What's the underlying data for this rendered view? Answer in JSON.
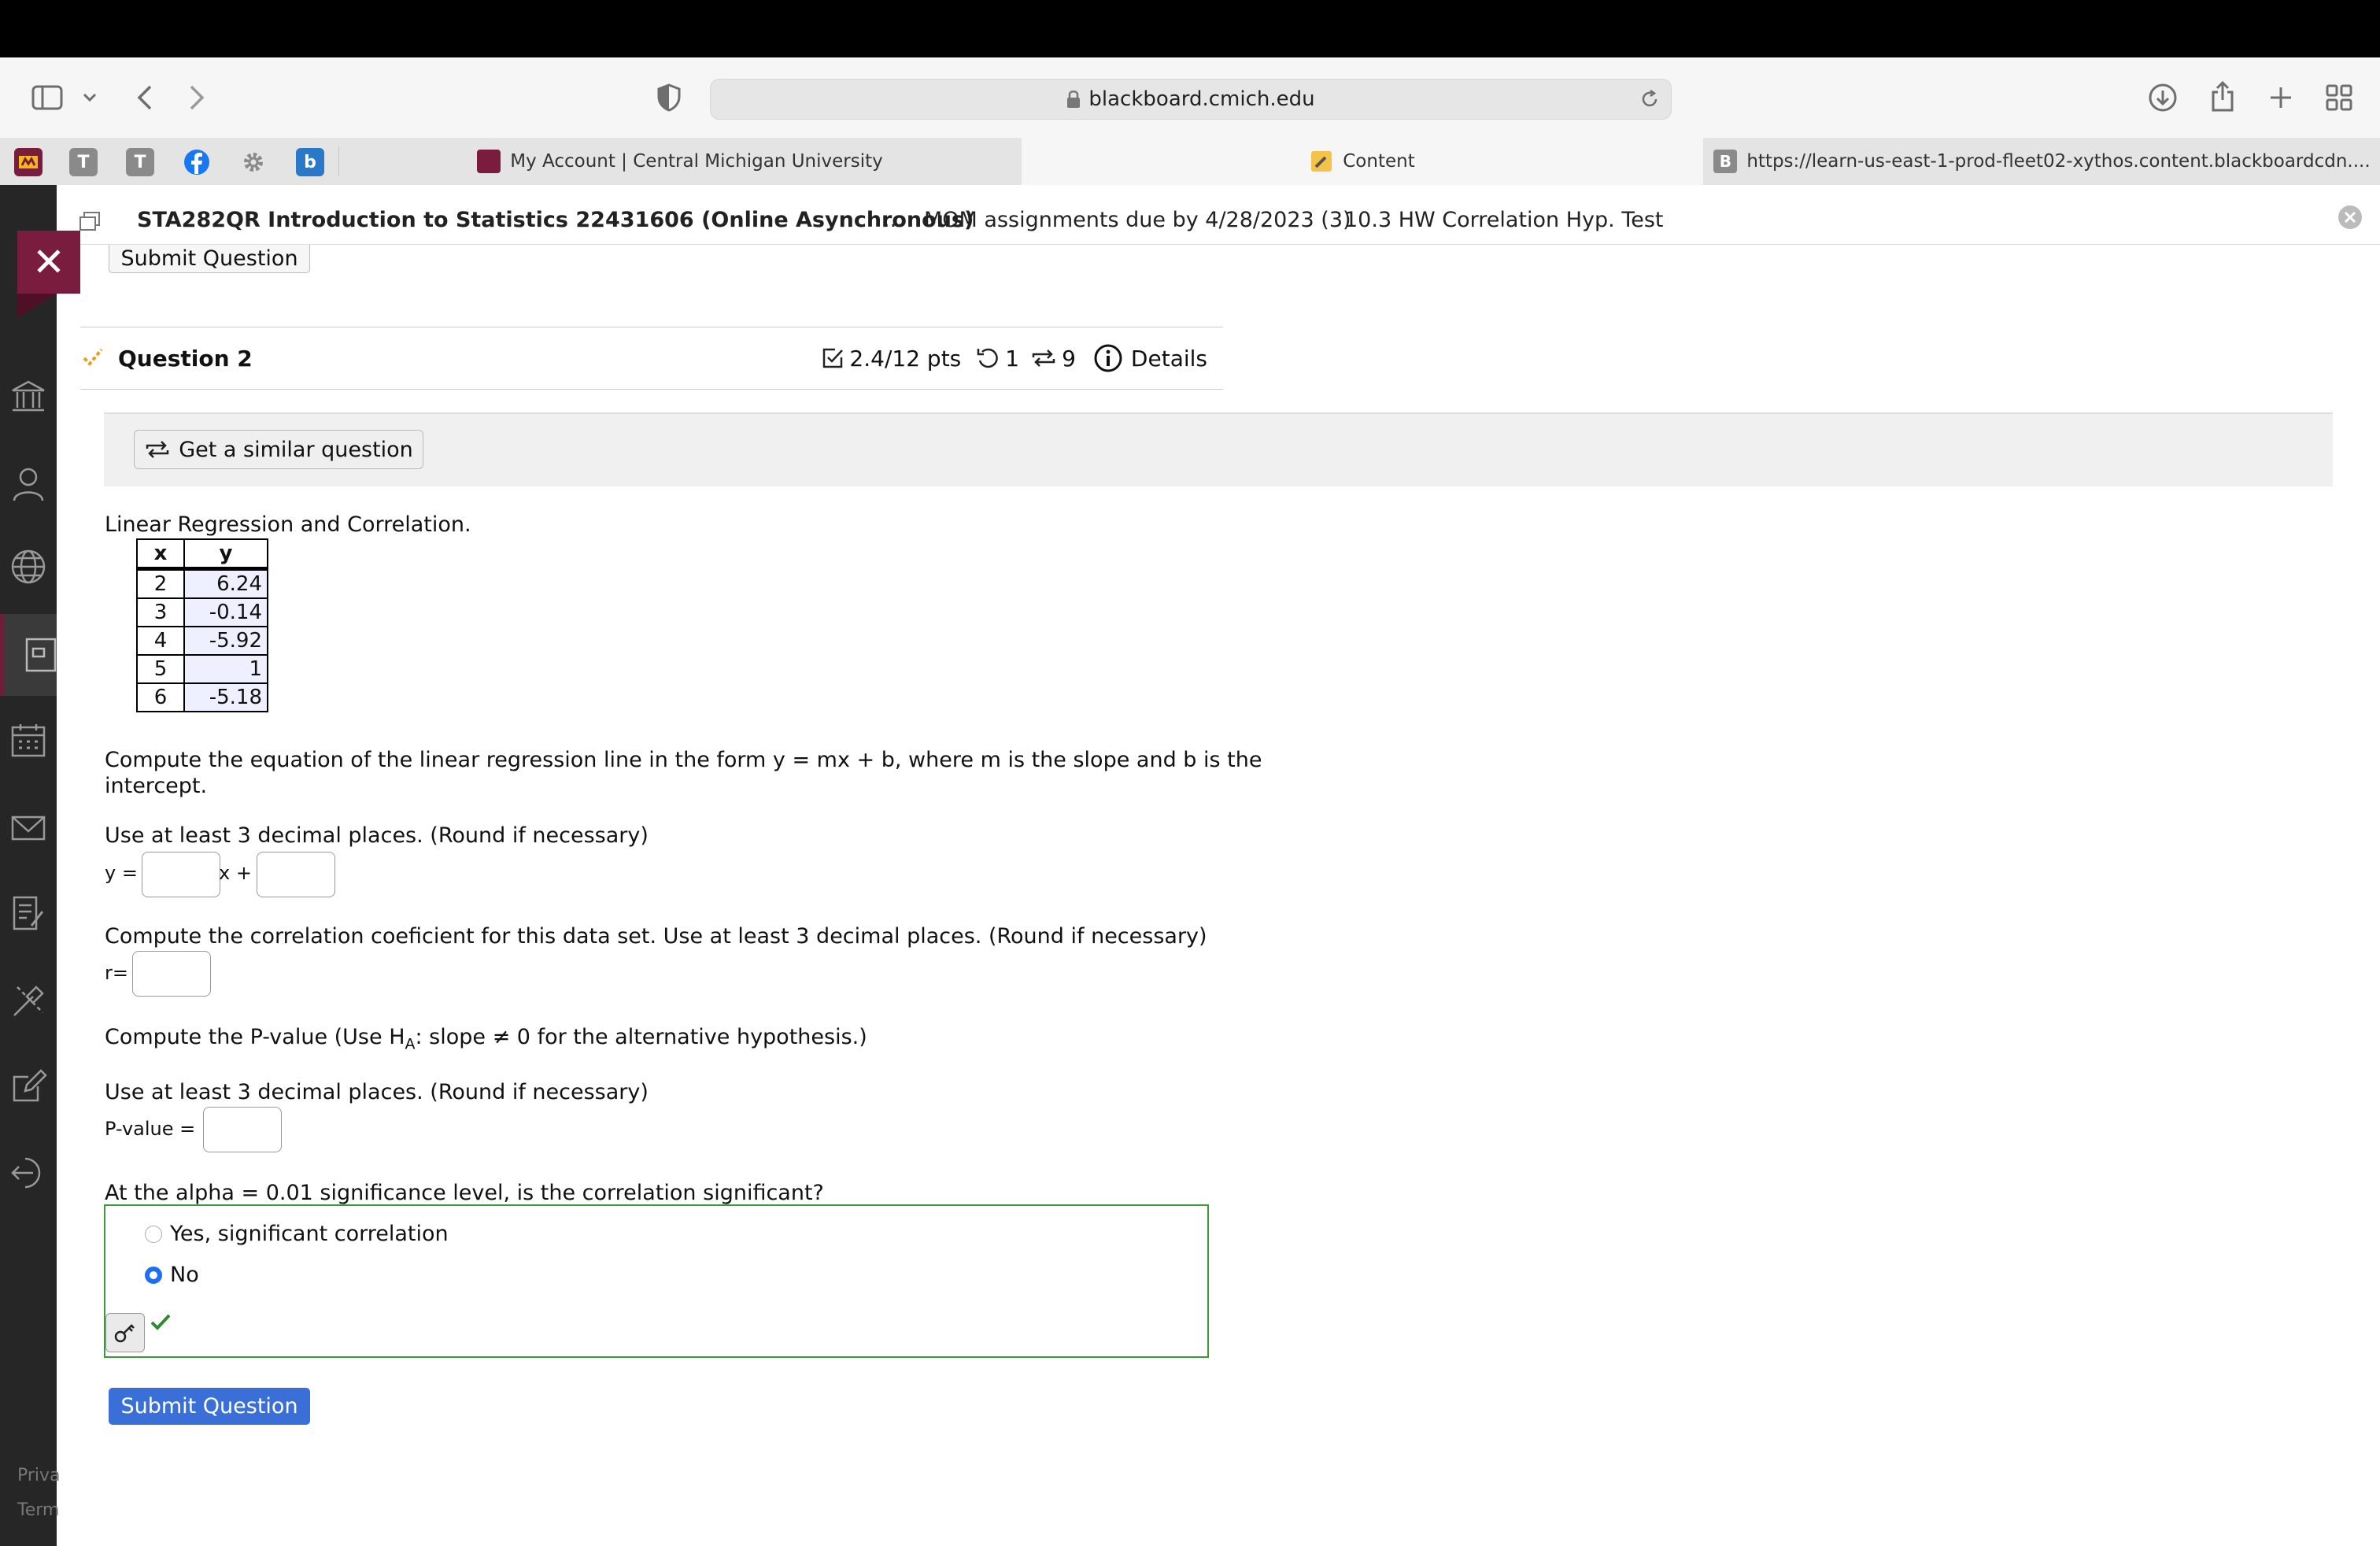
{
  "browser": {
    "url": "blackboard.cmich.edu",
    "tabs": [
      {
        "label": "My Account | Central Michigan University"
      },
      {
        "label": "Content"
      },
      {
        "label": "https://learn-us-east-1-prod-fleet02-xythos.content.blackboardcdn...."
      }
    ],
    "pinned_tabs": [
      "T",
      "T",
      "b"
    ],
    "tab_icon_letter": "B"
  },
  "breadcrumb": {
    "course": "STA282QR Introduction to Statistics 22431606 (Online Asynchronous)",
    "ellipsis": "...",
    "assignment": "MOM assignments due by 4/28/2023 (3)",
    "current": "10.3 HW Correlation Hyp. Test"
  },
  "sidebar_footer": {
    "privacy": "Priva",
    "terms": "Term"
  },
  "question": {
    "prev_submit_label": "Submit Question",
    "title": "Question 2",
    "points": "2.4/12 pts",
    "retries": "1",
    "attempts": "9",
    "details_label": "Details",
    "similar_label": "Get a similar question",
    "intro": "Linear Regression and Correlation.",
    "table": {
      "headers": [
        "x",
        "y"
      ],
      "rows": [
        [
          "2",
          "6.24"
        ],
        [
          "3",
          "-0.14"
        ],
        [
          "4",
          "-5.92"
        ],
        [
          "5",
          "1"
        ],
        [
          "6",
          "-5.18"
        ]
      ]
    },
    "part1_line1": "Compute the equation of the linear regression line in the form y = mx + b, where m is the slope and b is the",
    "part1_line2": "intercept.",
    "decimals_note": "Use at least 3 decimal places. (Round if necessary)",
    "y_label": "y =",
    "x_plus_label": "x +",
    "part2": "Compute the correlation coeficient for this data set. Use at least 3 decimal places. (Round if necessary)",
    "r_label": "r=",
    "part3_prefix": "Compute the P-value (Use H",
    "part3_sub": "A",
    "part3_suffix": ": slope ≠ 0 for the alternative hypothesis.)",
    "decimals_note_2": "Use at least 3 decimal places. (Round if necessary)",
    "pvalue_label": "P-value =",
    "part4": "At the alpha = 0.01 significance level, is the correlation significant?",
    "options": [
      {
        "label": "Yes, significant correlation",
        "selected": false
      },
      {
        "label": "No",
        "selected": true
      }
    ],
    "submit_label": "Submit Question"
  },
  "colors": {
    "accent": "#3a6fd8",
    "correct": "#3a9a3a",
    "sidebar": "#262626",
    "brand": "#7a1c3e"
  }
}
